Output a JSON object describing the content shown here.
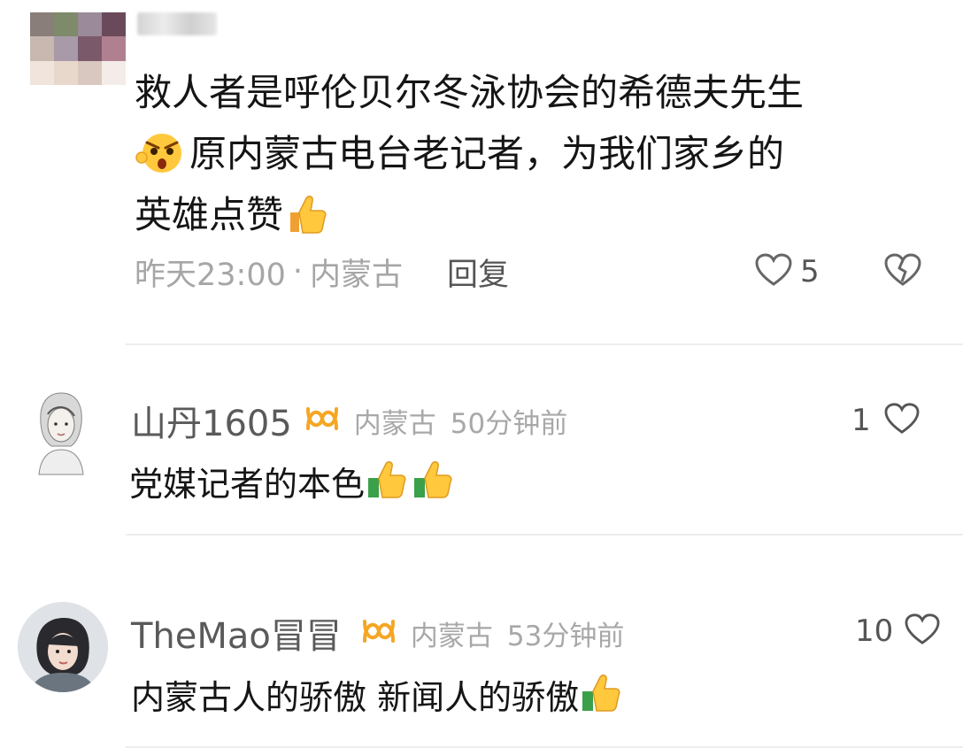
{
  "comments": [
    {
      "text_line1": "救人者是呼伦贝尔冬泳协会的希德夫先生",
      "text_line2": "原内蒙古电台老记者，为我们家乡的",
      "text_line3": "英雄点赞",
      "time": "昨天23:00",
      "sep": "·",
      "location": "内蒙古",
      "reply_label": "回复",
      "likes": "5"
    },
    {
      "username": "山丹1605",
      "location": "内蒙古",
      "time": "50分钟前",
      "likes": "1",
      "text": "党媒记者的本色"
    },
    {
      "username": "TheMao冒冒",
      "location": "内蒙古",
      "time": "53分钟前",
      "likes": "10",
      "text": "内蒙古人的骄傲 新闻人的骄傲"
    }
  ],
  "colors": {
    "badge": "#f5a623",
    "meta": "#a6a6a6",
    "divider": "#ededed"
  },
  "icons": [
    "shocked-face-emoji",
    "thumbs-up-emoji",
    "heart-icon",
    "broken-heart-icon",
    "infinity-badge-icon"
  ]
}
